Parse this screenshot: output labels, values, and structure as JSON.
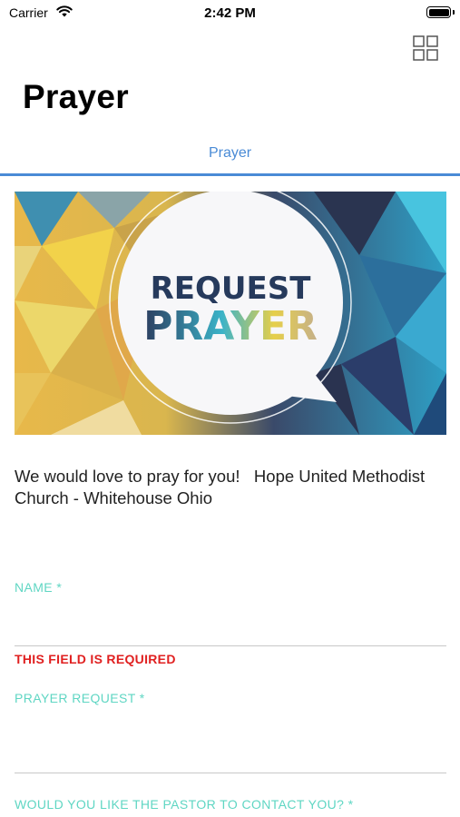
{
  "status_bar": {
    "carrier": "Carrier",
    "time": "2:42 PM"
  },
  "header": {
    "title": "Prayer",
    "grid_icon": "grid-icon"
  },
  "tabs": [
    {
      "label": "Prayer",
      "selected": true
    }
  ],
  "banner": {
    "line1": "REQUEST",
    "line2": "PRAYER"
  },
  "intro_text": "We would love to pray for you!   Hope United Methodist Church - Whitehouse Ohio",
  "form": {
    "name_label": "NAME *",
    "name_value": "",
    "name_error": "THIS FIELD IS REQUIRED",
    "prayer_label": "PRAYER REQUEST *",
    "prayer_value": "",
    "contact_label": "WOULD YOU LIKE THE PASTOR TO CONTACT YOU? *"
  },
  "colors": {
    "accent": "#4a8bd6",
    "label": "#5fd6c3",
    "error": "#e02020"
  }
}
